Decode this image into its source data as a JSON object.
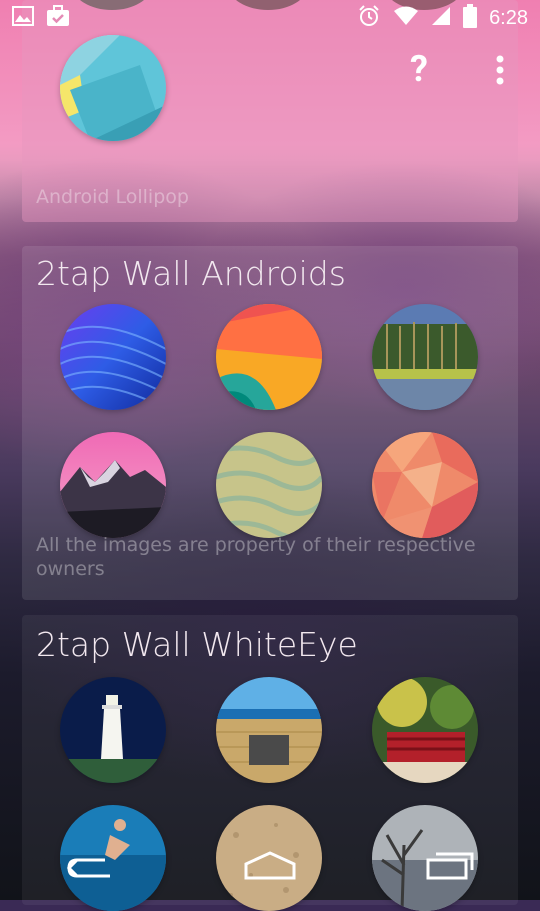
{
  "status_bar": {
    "time": "6:28",
    "icons_left": [
      "image-icon",
      "briefcase-check-icon"
    ],
    "icons_right": [
      "alarm-icon",
      "wifi-icon",
      "signal-icon",
      "battery-icon"
    ]
  },
  "collections": [
    {
      "title": "",
      "caption": "Android Lollipop",
      "actions": [
        "help-icon",
        "overflow-menu-icon"
      ],
      "help_label": "?"
    },
    {
      "title": "2tap Wall Androids",
      "caption": "All the images are property of their respective owners",
      "thumbnails": [
        "blue-waves-wallpaper",
        "lollipop-orange-wallpaper",
        "forest-lake-wallpaper",
        "pink-mountain-wallpaper",
        "sand-water-wallpaper",
        "coral-polygon-wallpaper"
      ]
    },
    {
      "title": "2tap Wall WhiteEye",
      "thumbnails": [
        "lighthouse-photo",
        "beach-plaque-photo",
        "red-bridge-garden-photo",
        "surf-jump-photo",
        "sand-texture-photo",
        "lake-tree-photo"
      ]
    }
  ],
  "nav_bar": {
    "buttons": [
      "back-icon",
      "home-icon",
      "recents-icon"
    ]
  },
  "colors": {
    "pink_top": "#f07fb1",
    "card_text": "#f2e8ef",
    "status_text": "#ffffff"
  }
}
